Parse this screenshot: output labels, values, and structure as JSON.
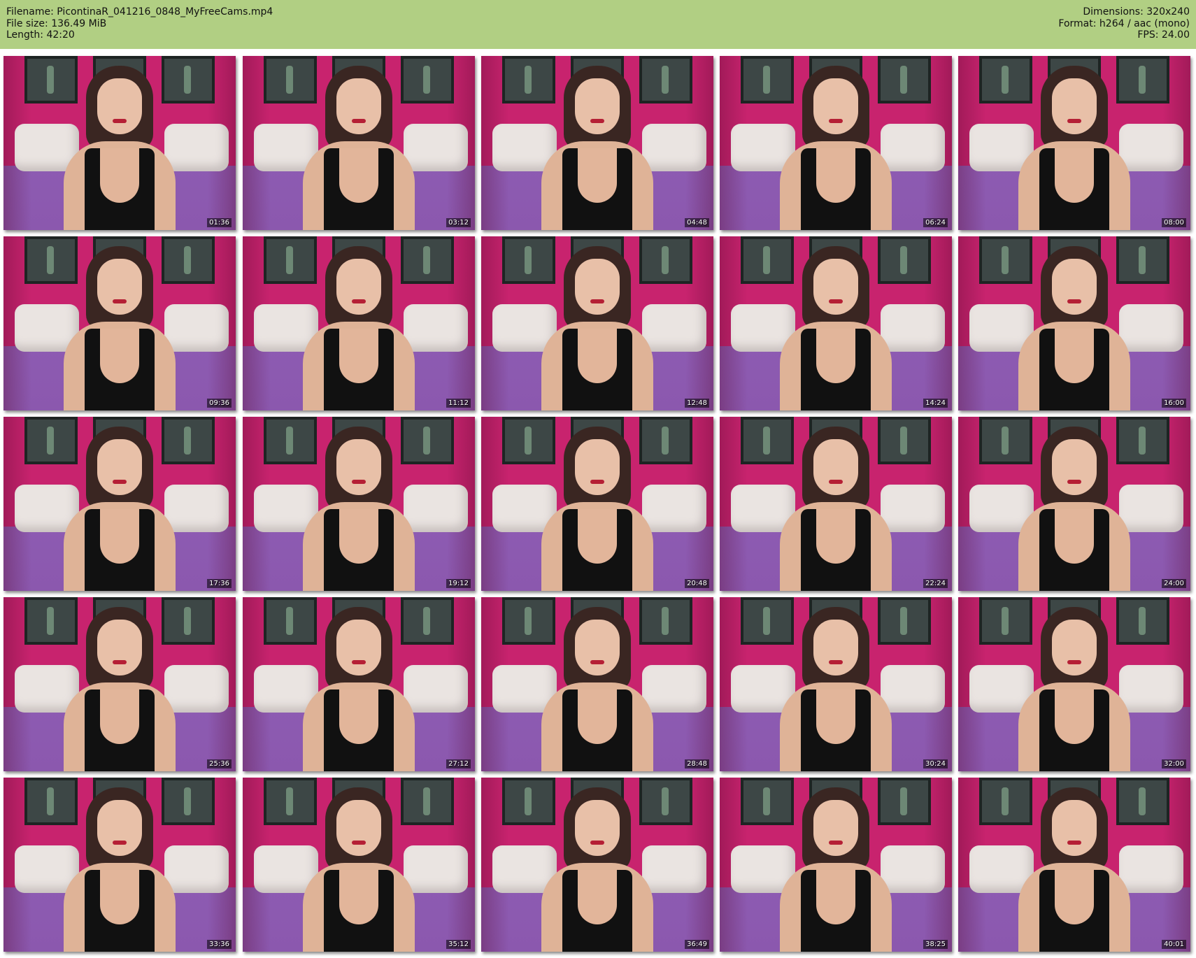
{
  "header": {
    "filename": "Filename: PicontinaR_041216_0848_MyFreeCams.mp4",
    "file_size": "File size: 136.49 MiB",
    "length": "Length: 42:20",
    "dimensions": "Dimensions: 320x240",
    "format": "Format: h264 / aac (mono)",
    "fps": "FPS: 24.00"
  },
  "thumbnails": [
    {
      "time": "01:36"
    },
    {
      "time": "03:12"
    },
    {
      "time": "04:48"
    },
    {
      "time": "06:24"
    },
    {
      "time": "08:00"
    },
    {
      "time": "09:36"
    },
    {
      "time": "11:12"
    },
    {
      "time": "12:48"
    },
    {
      "time": "14:24"
    },
    {
      "time": "16:00"
    },
    {
      "time": "17:36"
    },
    {
      "time": "19:12"
    },
    {
      "time": "20:48"
    },
    {
      "time": "22:24"
    },
    {
      "time": "24:00"
    },
    {
      "time": "25:36"
    },
    {
      "time": "27:12"
    },
    {
      "time": "28:48"
    },
    {
      "time": "30:24"
    },
    {
      "time": "32:00"
    },
    {
      "time": "33:36"
    },
    {
      "time": "35:12"
    },
    {
      "time": "36:49"
    },
    {
      "time": "38:25"
    },
    {
      "time": "40:01"
    }
  ]
}
